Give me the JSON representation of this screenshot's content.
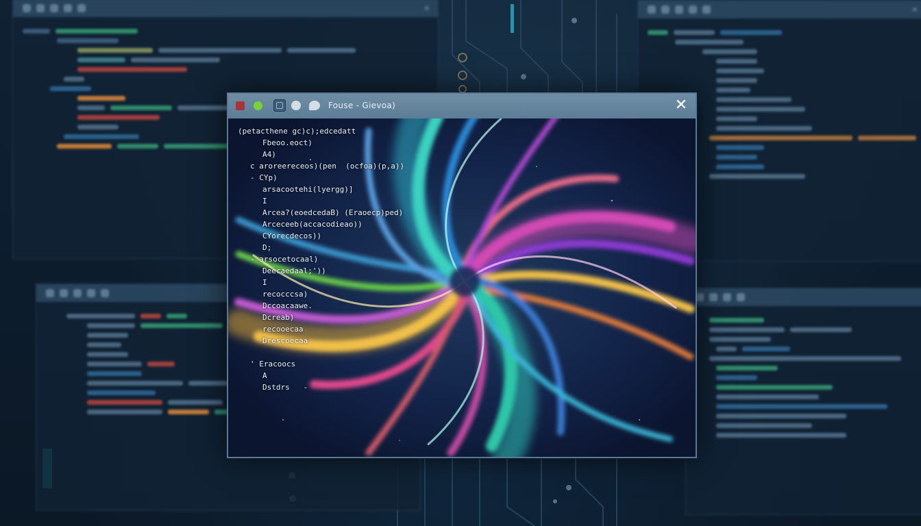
{
  "window": {
    "title": "Fouse - Gievoa)",
    "close_glyph": "✕",
    "buttons": [
      "close-square",
      "maximize-dot",
      "grid-icon",
      "bubble-icon",
      "chat-icon"
    ]
  },
  "code_lines": [
    {
      "indent": 0,
      "text": "(petacthene gc)c);edcedatt"
    },
    {
      "indent": 2,
      "text": "Fbeoo.eoct)"
    },
    {
      "indent": 2,
      "text": "A4)"
    },
    {
      "indent": 1,
      "text": "c aroreereceos)(pen  (ocfoa)(p,a))"
    },
    {
      "indent": 1,
      "text": "- CYp)"
    },
    {
      "indent": 2,
      "text": "arsacootehi(lyergg)]"
    },
    {
      "indent": 2,
      "text": "I"
    },
    {
      "indent": 2,
      "text": "Arcea?(eoedcedaB) (Eraoecp)ped)"
    },
    {
      "indent": 2,
      "text": "Arceceeb(accacodieao))"
    },
    {
      "indent": 2,
      "text": "CYorecdecos))"
    },
    {
      "indent": 2,
      "text": "D;"
    },
    {
      "indent": 1,
      "text": "- arsocetocaal)"
    },
    {
      "indent": 2,
      "text": "Deecaedaal;'))"
    },
    {
      "indent": 2,
      "text": "I"
    },
    {
      "indent": 2,
      "text": "recocccsa)"
    },
    {
      "indent": 2,
      "text": "Dccoacaawe."
    },
    {
      "indent": 2,
      "text": "Dcreab)"
    },
    {
      "indent": 2,
      "text": "recooecaa"
    },
    {
      "indent": 2,
      "text": "Drescoecaa"
    },
    {
      "indent": 0,
      "text": ""
    },
    {
      "indent": 1,
      "text": "' Eracoocs"
    },
    {
      "indent": 2,
      "text": "A"
    },
    {
      "indent": 2,
      "text": "Dstdrs   -"
    }
  ],
  "colors": {
    "background": "#0c1a2a",
    "window_border": "#5a7a94",
    "titlebar": "#6f8ea6",
    "close_red": "#a8333c",
    "accent_green": "#7bd13a"
  }
}
